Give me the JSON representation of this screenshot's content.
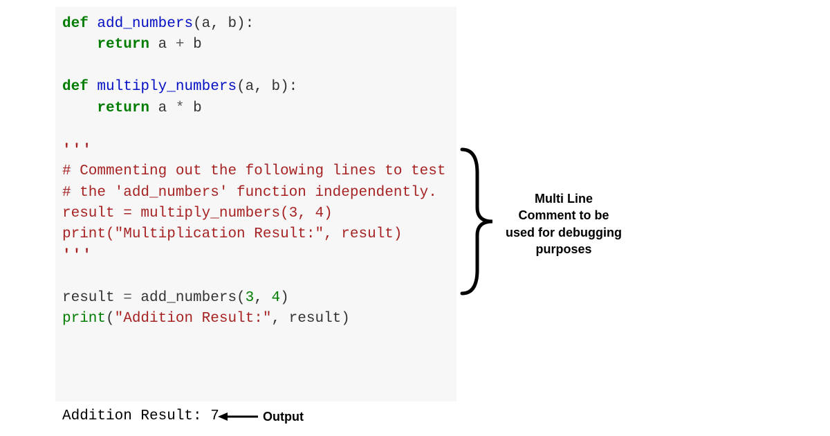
{
  "code": {
    "def1": "def",
    "fn1": "add_numbers",
    "params1_open": "(a, b):",
    "indent": "    ",
    "return1": "return",
    "expr1_a": "a",
    "expr1_op": "+",
    "expr1_b": "b",
    "def2": "def",
    "fn2": "multiply_numbers",
    "params2_open": "(a, b):",
    "return2": "return",
    "expr2_a": "a",
    "expr2_op": "*",
    "expr2_b": "b",
    "triple1": "'''",
    "comment1": "# Commenting out the following lines to test",
    "comment2": "# the 'add_numbers' function independently.",
    "res1_left": "result = multiply_numbers(",
    "res1_args": "3, 4",
    "res1_right": ")",
    "print1_fn": "print",
    "print1_open": "(",
    "print1_str": "\"Multiplication Result:\"",
    "print1_rest": ", result)",
    "triple2": "'''",
    "res2_var": "result ",
    "res2_eq": "=",
    "res2_sp": " add_numbers(",
    "res2_n1": "3",
    "res2_comma": ", ",
    "res2_n2": "4",
    "res2_close": ")",
    "print2_fn": "print",
    "print2_open": "(",
    "print2_str": "\"Addition Result:\"",
    "print2_rest": ", result)"
  },
  "output": {
    "text": "Addition Result: 7",
    "label": "Output"
  },
  "annotation": {
    "text": "Multi Line Comment to be used for debugging purposes"
  }
}
